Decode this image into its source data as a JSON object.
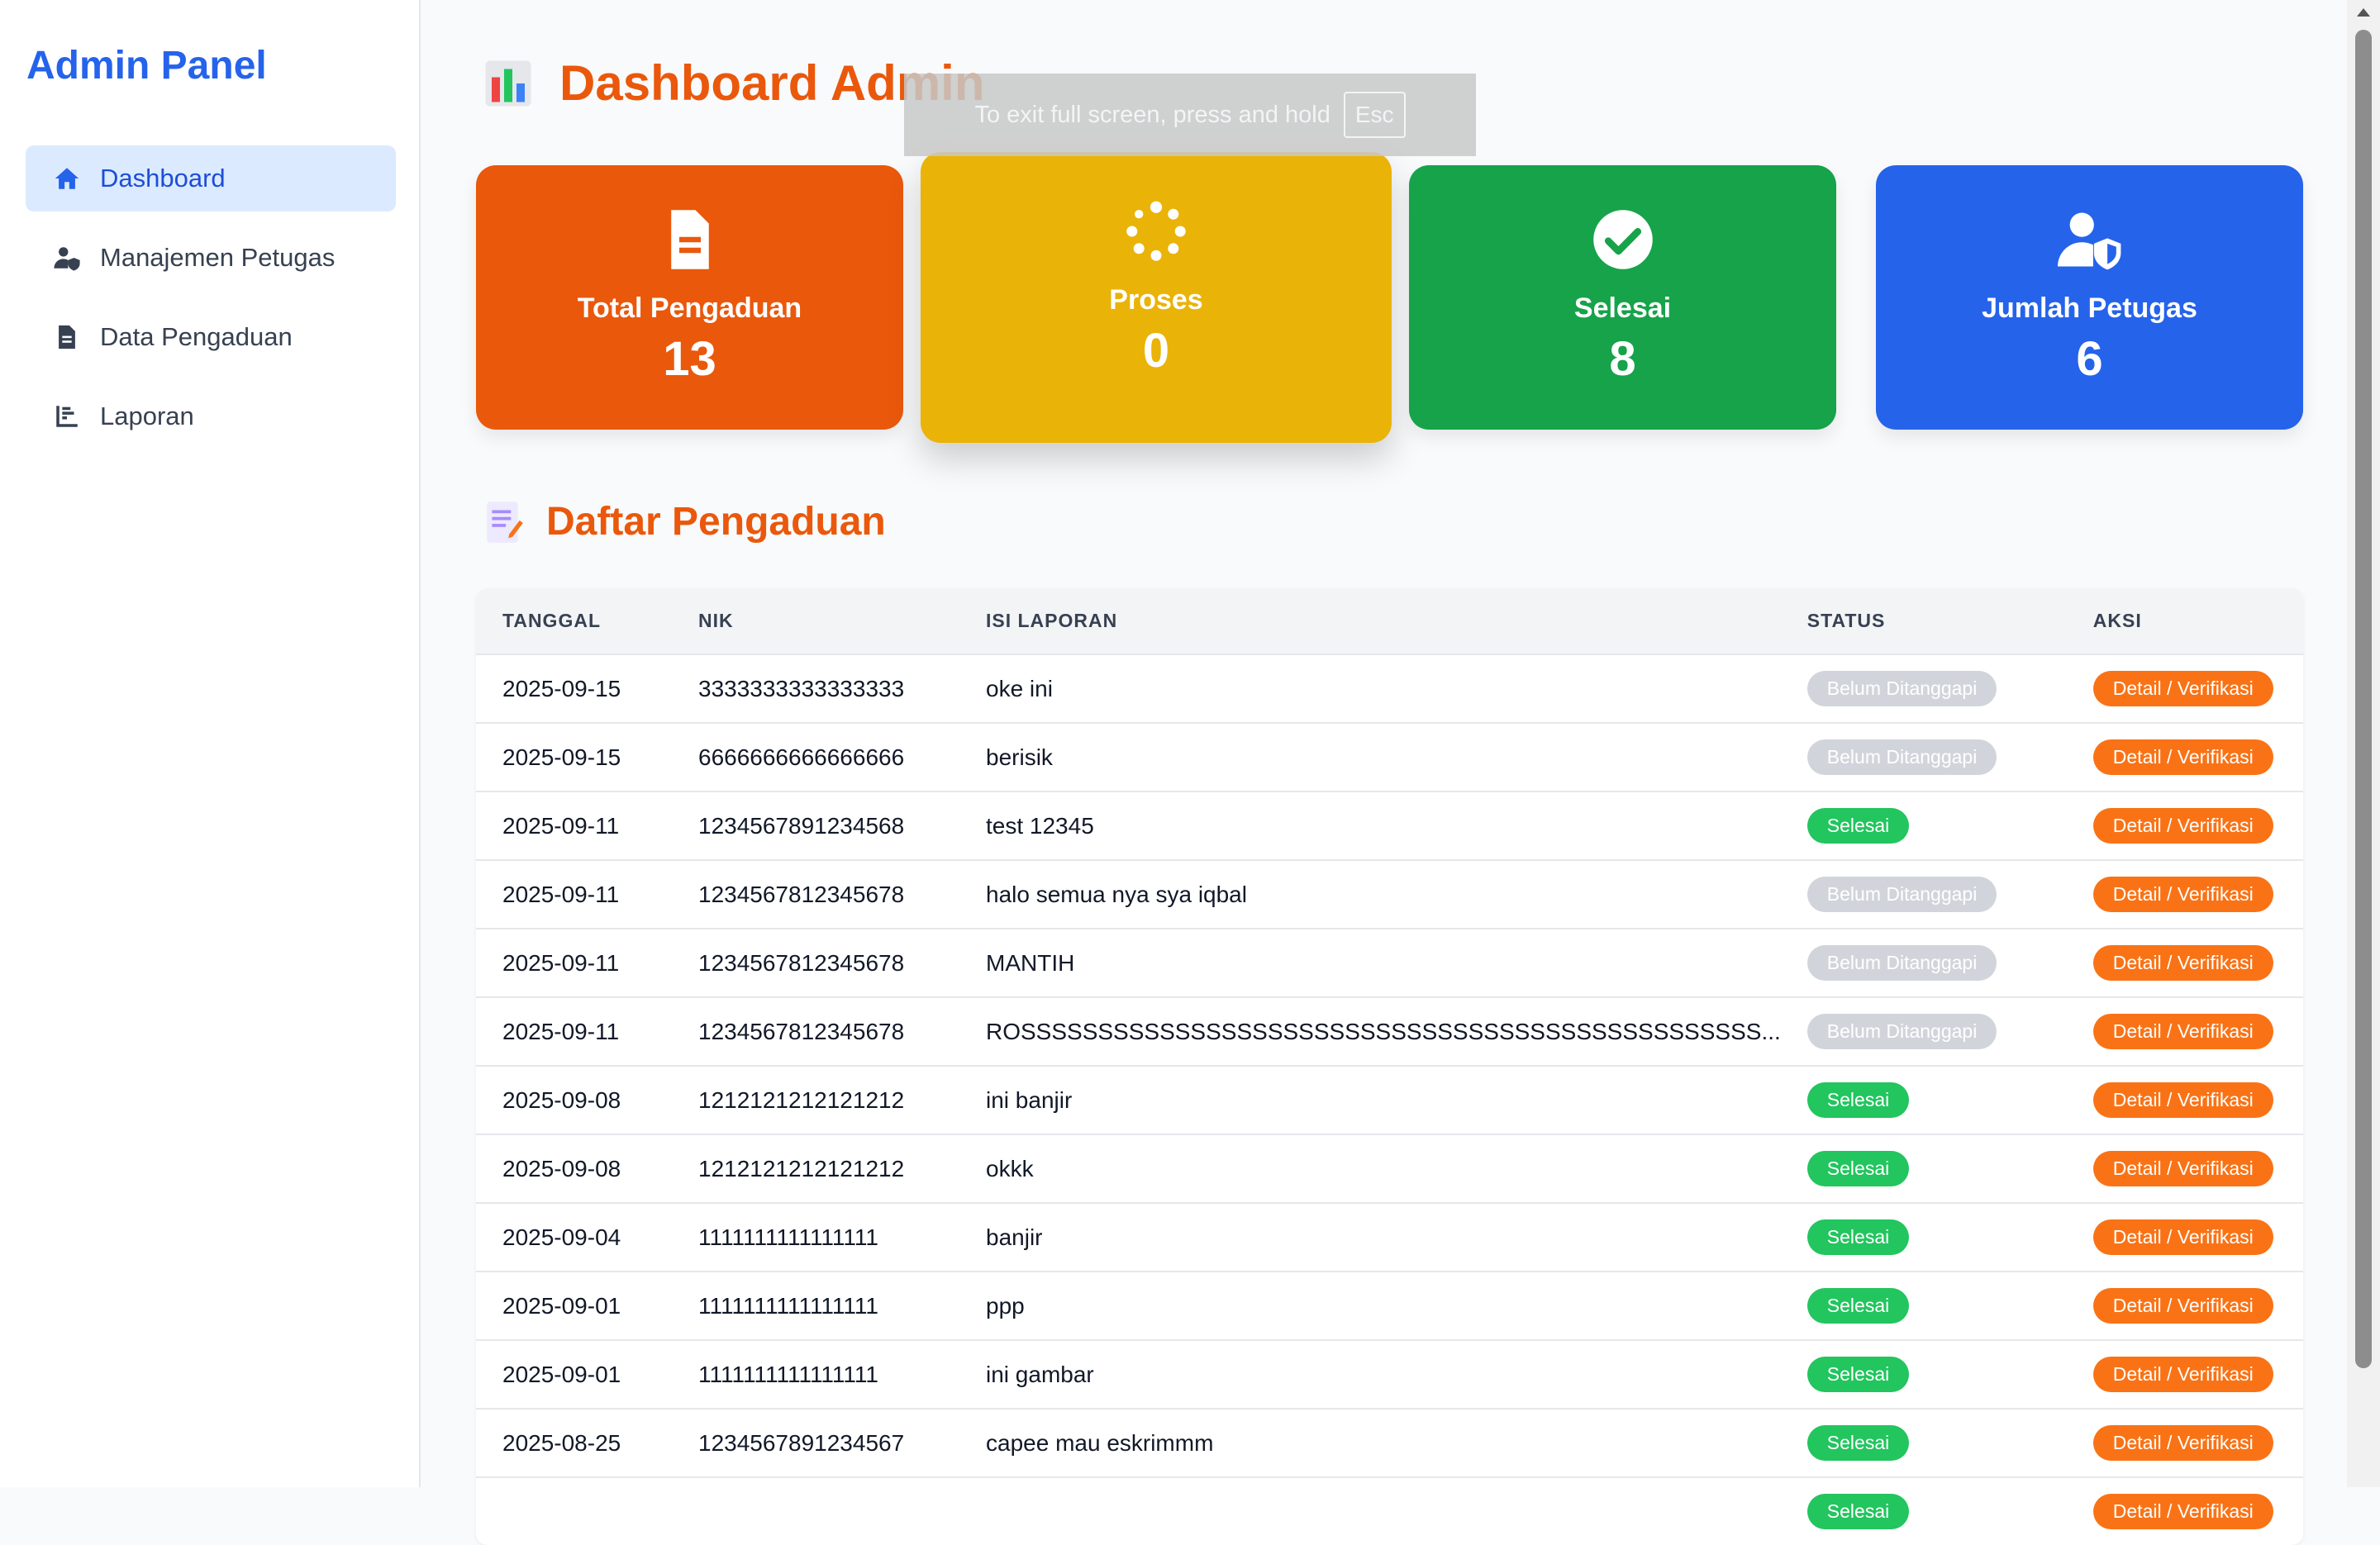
{
  "sidebar": {
    "brand": "Admin Panel",
    "items": [
      {
        "label": "Dashboard",
        "icon": "home-icon",
        "active": true
      },
      {
        "label": "Manajemen Petugas",
        "icon": "user-shield-icon",
        "active": false
      },
      {
        "label": "Data Pengaduan",
        "icon": "file-icon",
        "active": false
      },
      {
        "label": "Laporan",
        "icon": "chart-icon",
        "active": false
      }
    ]
  },
  "header": {
    "title": "Dashboard Admin",
    "fullscreen_notice": "To exit full screen, press and hold",
    "fullscreen_key": "Esc"
  },
  "cards": [
    {
      "label": "Total Pengaduan",
      "value": "13",
      "color": "#ea580c",
      "icon": "file-icon"
    },
    {
      "label": "Proses",
      "value": "0",
      "color": "#eab308",
      "icon": "spinner-icon"
    },
    {
      "label": "Selesai",
      "value": "8",
      "color": "#16a34a",
      "icon": "check-circle-icon"
    },
    {
      "label": "Jumlah Petugas",
      "value": "6",
      "color": "#2563eb",
      "icon": "user-shield-icon"
    }
  ],
  "section": {
    "title": "Daftar Pengaduan"
  },
  "table": {
    "headers": [
      "TANGGAL",
      "NIK",
      "ISI LAPORAN",
      "STATUS",
      "AKSI"
    ],
    "action_label": "Detail / Verifikasi",
    "rows": [
      {
        "tanggal": "2025-09-15",
        "nik": "3333333333333333",
        "isi": "oke ini",
        "status": "Belum Ditanggapi"
      },
      {
        "tanggal": "2025-09-15",
        "nik": "6666666666666666",
        "isi": "berisik",
        "status": "Belum Ditanggapi"
      },
      {
        "tanggal": "2025-09-11",
        "nik": "1234567891234568",
        "isi": "test 12345",
        "status": "Selesai"
      },
      {
        "tanggal": "2025-09-11",
        "nik": "1234567812345678",
        "isi": "halo semua nya sya iqbal",
        "status": "Belum Ditanggapi"
      },
      {
        "tanggal": "2025-09-11",
        "nik": "1234567812345678",
        "isi": "MANTIH",
        "status": "Belum Ditanggapi"
      },
      {
        "tanggal": "2025-09-11",
        "nik": "1234567812345678",
        "isi": "ROSSSSSSSSSSSSSSSSSSSSSSSSSSSSSSSSSSSSSSSSSSSSSSSS...",
        "status": "Belum Ditanggapi"
      },
      {
        "tanggal": "2025-09-08",
        "nik": "1212121212121212",
        "isi": "ini banjir",
        "status": "Selesai"
      },
      {
        "tanggal": "2025-09-08",
        "nik": "1212121212121212",
        "isi": "okkk",
        "status": "Selesai"
      },
      {
        "tanggal": "2025-09-04",
        "nik": "1111111111111111",
        "isi": "banjir",
        "status": "Selesai"
      },
      {
        "tanggal": "2025-09-01",
        "nik": "1111111111111111",
        "isi": "ppp",
        "status": "Selesai"
      },
      {
        "tanggal": "2025-09-01",
        "nik": "1111111111111111",
        "isi": "ini gambar",
        "status": "Selesai"
      },
      {
        "tanggal": "2025-08-25",
        "nik": "1234567891234567",
        "isi": "capee mau eskrimmm",
        "status": "Selesai"
      },
      {
        "tanggal": "",
        "nik": "",
        "isi": "",
        "status": "Selesai"
      }
    ]
  },
  "colors": {
    "brand": "#2563eb",
    "accent": "#ea580c",
    "status_done": "#22c55e",
    "status_pending": "#d1d5db",
    "action": "#f97316"
  }
}
